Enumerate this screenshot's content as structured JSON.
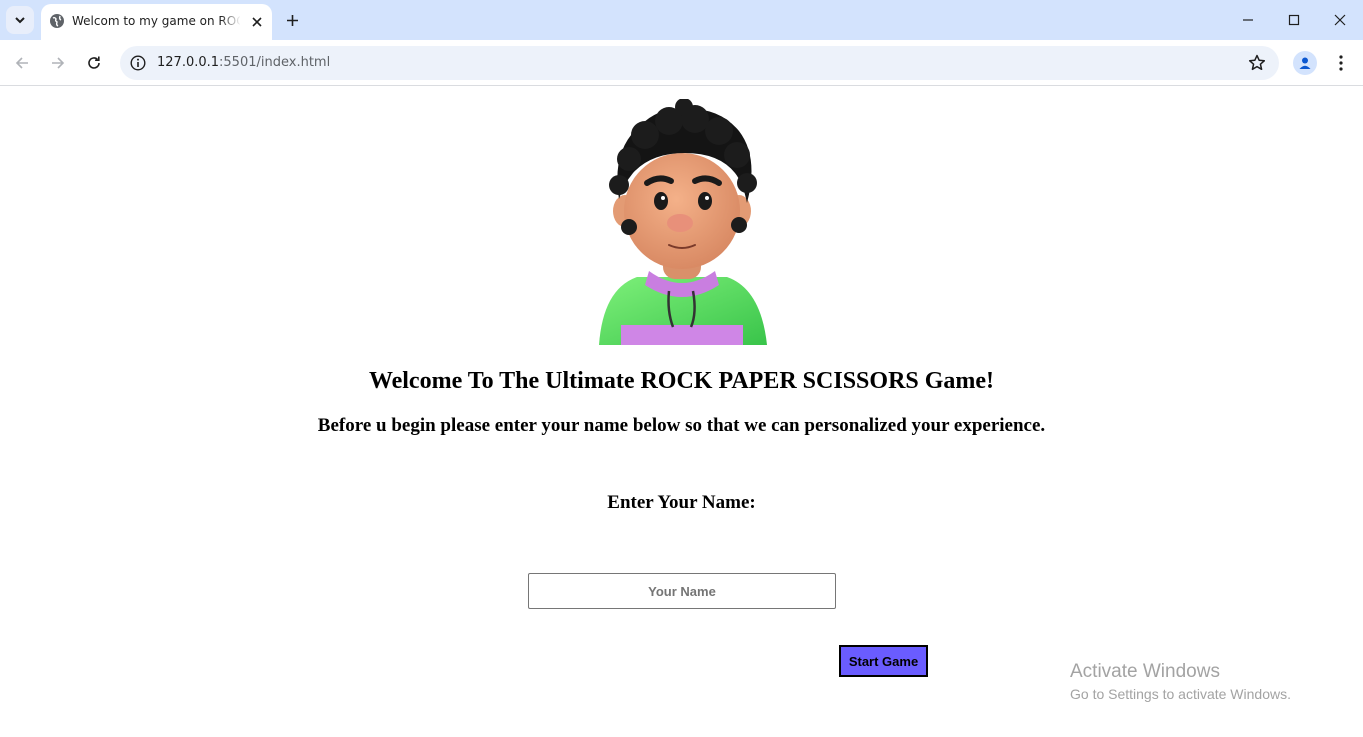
{
  "browser": {
    "tab_title": "Welcom to my game on ROCK PAPER SCISSORS",
    "url_host": "127.0.0.1",
    "url_path": ":5501/index.html",
    "icons": {
      "tab_list": "chevron-down-icon",
      "favicon": "globe-icon",
      "close_tab": "close-icon",
      "new_tab": "plus-icon",
      "back": "arrow-left-icon",
      "forward": "arrow-right-icon",
      "reload": "reload-icon",
      "site_info": "info-icon",
      "bookmark": "star-icon",
      "profile": "person-icon",
      "menu": "kebab-menu-icon",
      "minimize": "minimize-icon",
      "maximize": "maximize-icon",
      "close_window": "close-icon"
    }
  },
  "page": {
    "heading": "Welcome To The Ultimate ROCK PAPER SCISSORS Game!",
    "subheading": "Before u begin please enter your name below so that we can personalized your experience.",
    "name_label": "Enter Your Name:",
    "name_input": {
      "placeholder": "Your Name",
      "value": ""
    },
    "start_button": "Start Game",
    "avatar": "cartoon-boy-avatar"
  },
  "os_watermark": {
    "title": "Activate Windows",
    "subtitle": "Go to Settings to activate Windows."
  },
  "colors": {
    "tabstrip": "#d3e3fd",
    "start_button": "#6a5cff",
    "omnibox": "#edf2fa"
  }
}
